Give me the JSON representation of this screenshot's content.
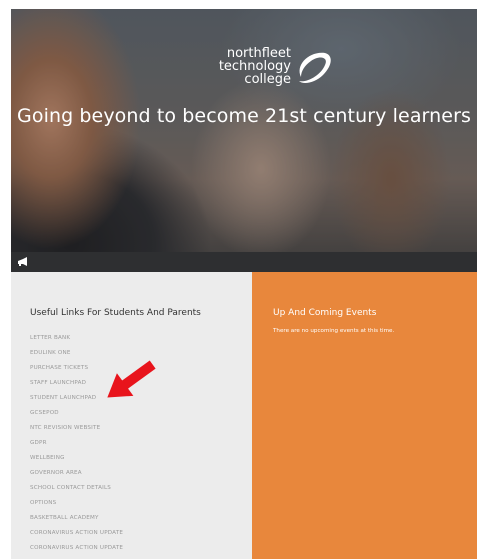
{
  "hero": {
    "logo_lines": [
      "northfleet",
      "technology",
      "college"
    ],
    "tagline": "Going beyond to become 21st century learners",
    "bar_icon": "megaphone-icon"
  },
  "useful_links": {
    "title": "Useful Links For Students And Parents",
    "items": [
      "LETTER BANK",
      "EDULINK ONE",
      "PURCHASE TICKETS",
      "STAFF LAUNCHPAD",
      "STUDENT LAUNCHPAD",
      "GCSEPOD",
      "NTC REVISION WEBSITE",
      "GDPR",
      "WELLBEING",
      "GOVERNOR AREA",
      "SCHOOL CONTACT DETAILS",
      "OPTIONS",
      "BASKETBALL ACADEMY",
      "CORONAVIRUS ACTION UPDATE",
      "CORONAVIRUS ACTION UPDATE"
    ]
  },
  "events": {
    "title": "Up And Coming Events",
    "empty_text": "There are no upcoming events at this time."
  },
  "colors": {
    "events_bg": "#e8873c",
    "links_bg": "#ececec",
    "bar_bg": "#2e2f31",
    "annotation_arrow": "#e8141c"
  },
  "annotation": {
    "icon": "red-arrow-icon"
  }
}
